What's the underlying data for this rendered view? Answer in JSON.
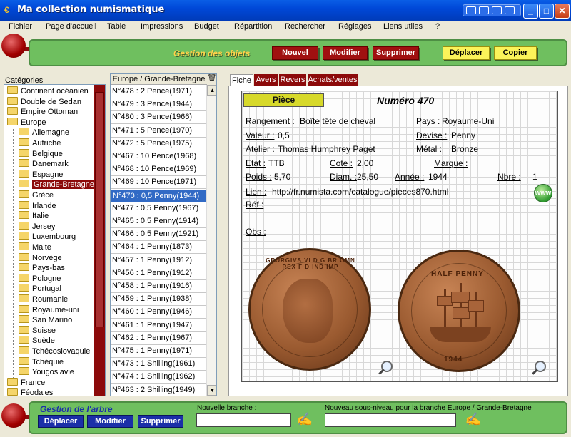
{
  "window": {
    "title": "Ma collection numismatique"
  },
  "menu": [
    "Fichier",
    "Page d'accueil",
    "Table",
    "Impressions",
    "Budget",
    "Répartition",
    "Rechercher",
    "Réglages",
    "Liens utiles",
    "?"
  ],
  "gestion_objets": {
    "title": "Gestion des objets",
    "nouvel": "Nouvel",
    "modifier": "Modifier",
    "supprimer": "Supprimer",
    "deplacer": "Déplacer",
    "copier": "Copier"
  },
  "categories": {
    "label": "Catégories",
    "items": [
      {
        "label": "Continent océanien",
        "level": 0
      },
      {
        "label": "Double de Sedan",
        "level": 0
      },
      {
        "label": "Empire Ottoman",
        "level": 0
      },
      {
        "label": "Europe",
        "level": 0,
        "open": true
      },
      {
        "label": "Allemagne",
        "level": 1
      },
      {
        "label": "Autriche",
        "level": 1
      },
      {
        "label": "Belgique",
        "level": 1
      },
      {
        "label": "Danemark",
        "level": 1
      },
      {
        "label": "Espagne",
        "level": 1
      },
      {
        "label": "Grande-Bretagne",
        "level": 1,
        "selected": true
      },
      {
        "label": "Grèce",
        "level": 1
      },
      {
        "label": "Irlande",
        "level": 1
      },
      {
        "label": "Italie",
        "level": 1
      },
      {
        "label": "Jersey",
        "level": 1
      },
      {
        "label": "Luxembourg",
        "level": 1
      },
      {
        "label": "Malte",
        "level": 1
      },
      {
        "label": "Norvège",
        "level": 1
      },
      {
        "label": "Pays-bas",
        "level": 1
      },
      {
        "label": "Pologne",
        "level": 1
      },
      {
        "label": "Portugal",
        "level": 1
      },
      {
        "label": "Roumanie",
        "level": 1
      },
      {
        "label": "Royaume-uni",
        "level": 1
      },
      {
        "label": "San Marino",
        "level": 1
      },
      {
        "label": "Suisse",
        "level": 1
      },
      {
        "label": "Suède",
        "level": 1
      },
      {
        "label": "Tchécoslovaquie",
        "level": 1
      },
      {
        "label": "Tchéquie",
        "level": 1
      },
      {
        "label": "Yougoslavie",
        "level": 1
      },
      {
        "label": "France",
        "level": 0
      },
      {
        "label": "Féodales",
        "level": 0
      }
    ]
  },
  "coin_list": {
    "header": "Europe / Grande-Bretagne",
    "rows": [
      "N°478 : 2 Pence(1971)",
      "N°479 : 3 Pence(1944)",
      "N°480 : 3 Pence(1966)",
      "N°471 : 5 Pence(1970)",
      "N°472 : 5 Pence(1975)",
      "N°467 : 10 Pence(1968)",
      "N°468 : 10 Pence(1969)",
      "N°469 : 10 Pence(1971)",
      "N°470 : 0,5 Penny(1944)",
      "N°477 : 0,5 Penny(1967)",
      "N°465 : 0.5 Penny(1914)",
      "N°466 : 0.5 Penny(1921)",
      "N°464 : 1 Penny(1873)",
      "N°457 : 1 Penny(1912)",
      "N°456 : 1 Penny(1912)",
      "N°458 : 1 Penny(1916)",
      "N°459 : 1 Penny(1938)",
      "N°460 : 1 Penny(1946)",
      "N°461 : 1 Penny(1947)",
      "N°462 : 1 Penny(1967)",
      "N°475 : 1 Penny(1971)",
      "N°473 : 1 Shilling(1961)",
      "N°474 : 1 Shilling(1962)",
      "N°463 : 2 Shilling(1949)"
    ],
    "selected_index": 8
  },
  "tabs": [
    "Fiche",
    "Avers",
    "Revers",
    "Achats/ventes"
  ],
  "fiche": {
    "piece_label": "Pièce",
    "numero": "Numéro 470",
    "rangement_label": "Rangement :",
    "rangement": "Boîte tête de cheval",
    "pays_label": "Pays :",
    "pays": "Royaume-Uni",
    "valeur_label": "Valeur :",
    "valeur": "0,5",
    "devise_label": "Devise :",
    "devise": "Penny",
    "atelier_label": "Atelier :",
    "atelier": "Thomas Humphrey Paget",
    "metal_label": "Métal :",
    "metal": "Bronze",
    "etat_label": "Etat :",
    "etat": "TTB",
    "cote_label": "Cote :",
    "cote": "2,00",
    "marque_label": "Marque :",
    "poids_label": "Poids :",
    "poids": "5,70",
    "diam_label": "Diam. :",
    "diam": "25,50",
    "annee_label": "Année :",
    "annee": "1944",
    "nbre_label": "Nbre :",
    "nbre": "1",
    "lien_label": "Lien :",
    "lien": "http://fr.numista.com/catalogue/pieces870.html",
    "ref_label": "Réf :",
    "obs_label": "Obs :",
    "www": "WWW",
    "obverse_legend": "GEORGIVS VI D G BR OMN REX F D IND IMP",
    "reverse_legend": "HALF PENNY",
    "reverse_year": "1944"
  },
  "gestion_arbre": {
    "title": "Gestion de l'arbre",
    "deplacer": "Déplacer",
    "modifier": "Modifier",
    "supprimer": "Supprimer",
    "nouvelle_branche_label": "Nouvelle branche :",
    "nouvelle_branche_value": "",
    "sous_niveau_label": "Nouveau sous-niveau pour la branche Europe / Grande-Bretagne",
    "sous_niveau_value": ""
  },
  "colors": {
    "accent_red": "#8c0a0a",
    "bar_green": "#6fbf5f",
    "button_yellow": "#fbf35a",
    "button_blue": "#1b2fa8",
    "title_blue": "#0048d8"
  }
}
